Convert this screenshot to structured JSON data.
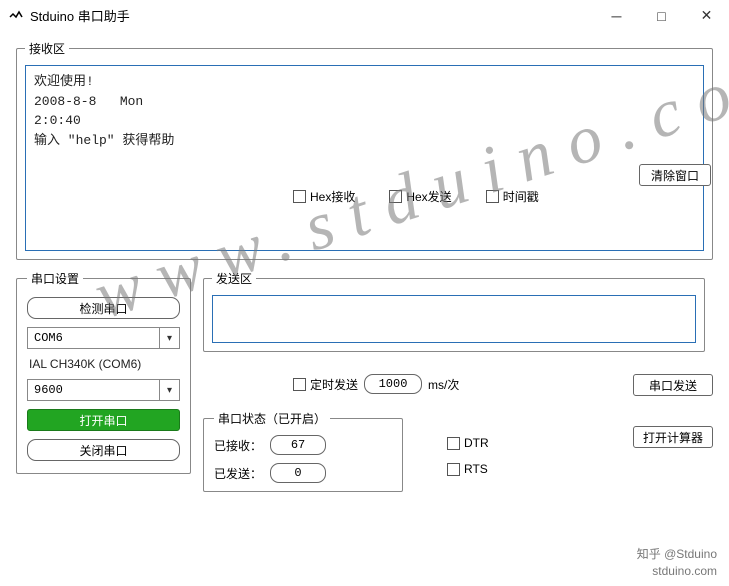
{
  "window": {
    "title": "Stduino 串口助手"
  },
  "receive": {
    "legend": "接收区",
    "content": "欢迎使用!\n2008-8-8   Mon\n2:0:40\n输入 \"help\" 获得帮助"
  },
  "clear_button": "清除窗口",
  "serial_settings": {
    "legend": "串口设置",
    "detect_button": "检测串口",
    "port_select": "COM6",
    "port_desc": "IAL CH340K (COM6)",
    "baud_select": "9600",
    "open_button": "打开串口",
    "close_button": "关闭串口"
  },
  "send": {
    "legend": "发送区",
    "hex_recv": "Hex接收",
    "hex_send": "Hex发送",
    "timestamp": "时间戳"
  },
  "timer": {
    "label": "定时发送",
    "value": "1000",
    "unit": "ms/次"
  },
  "serial_send_button": "串口发送",
  "open_calc_button": "打开计算器",
  "status": {
    "legend": "串口状态（已开启）",
    "recv_label": "已接收：",
    "recv_count": "67",
    "send_label": "已发送：",
    "send_count": "0"
  },
  "dtr_label": "DTR",
  "rts_label": "RTS",
  "watermark_main": "www.stduino.com",
  "watermark_corner1": "知乎 @Stduino",
  "watermark_corner2": "stduino.com"
}
